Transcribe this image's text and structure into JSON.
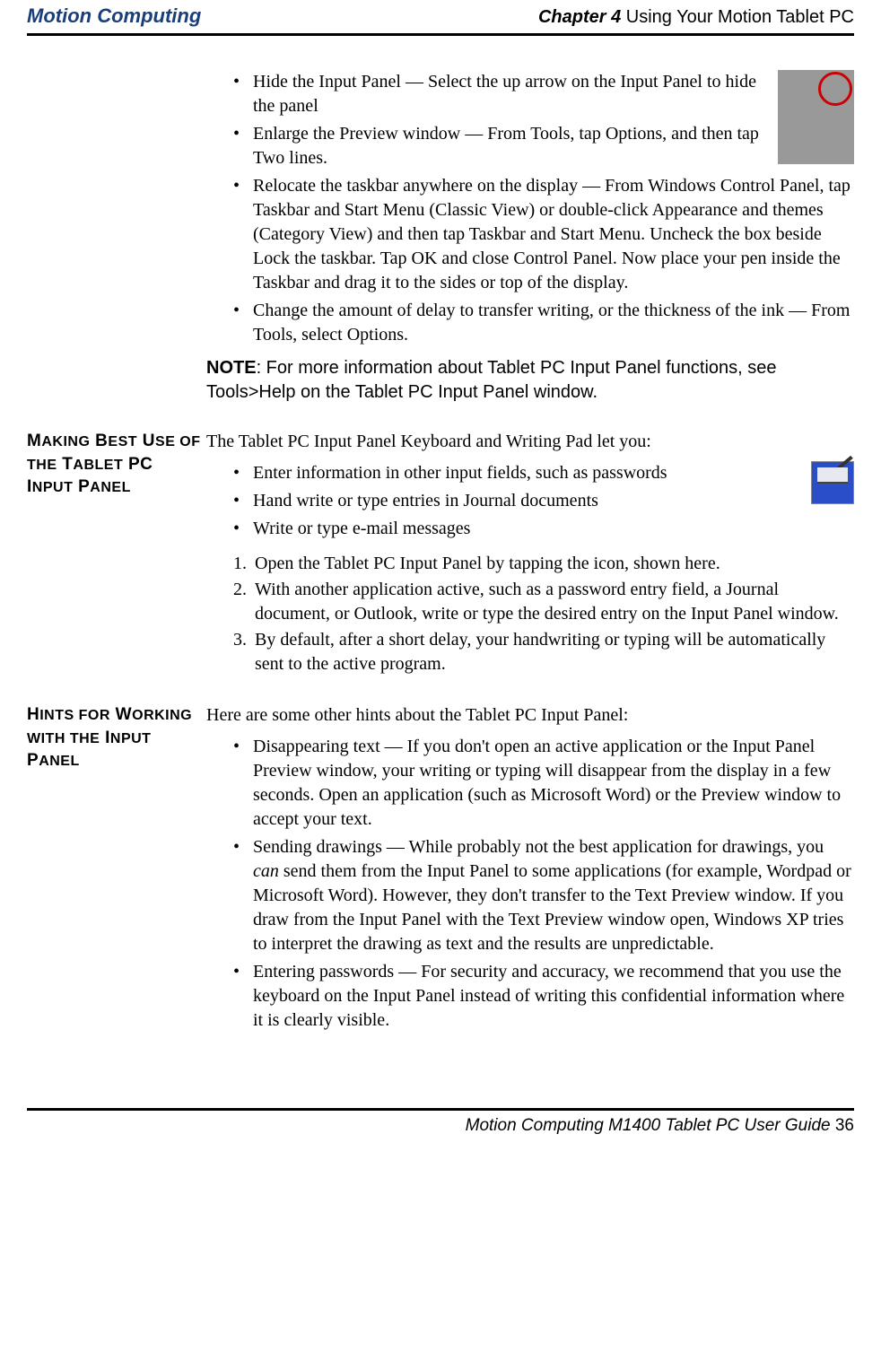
{
  "header": {
    "logo_text": "Motion Computing",
    "chapter_bold": "Chapter 4",
    "chapter_rest": " Using Your Motion Tablet PC"
  },
  "top_bullets": [
    "Hide the Input Panel — Select the up arrow on the Input Panel to hide the panel",
    "Enlarge the Preview window — From Tools, tap Options, and then tap Two lines.",
    "Relocate the taskbar anywhere on the display — From Windows Control Panel, tap Taskbar and Start Menu (Classic View) or double-click Appearance and themes (Category View) and then tap Taskbar and Start Menu. Uncheck the box beside Lock the taskbar. Tap OK and close Control Panel. Now place your pen inside the Taskbar and drag it to the sides or top of the display.",
    "Change the amount of delay to transfer writing, or the thickness of the ink — From Tools, select Options."
  ],
  "note": {
    "label": "NOTE",
    "text": ": For more information about Tablet PC Input Panel functions, see Tools>Help on the Tablet PC Input Panel window."
  },
  "section1": {
    "heading": "MAKING BEST USE OF THE TABLET PC INPUT PANEL",
    "intro": "The Tablet PC Input Panel Keyboard and Writing Pad let you:",
    "bullets": [
      "Enter information in other input fields, such as passwords",
      "Hand write or type entries in Journal documents",
      "Write or type e-mail messages"
    ],
    "numbered": [
      "Open the Tablet PC Input Panel by tapping the icon, shown here.",
      "With another application active, such as a password entry field, a Journal document, or Outlook, write or type the desired entry on the Input Panel window.",
      "By default, after a short delay, your handwriting or typing will be automatically sent to the active program."
    ]
  },
  "section2": {
    "heading": "HINTS FOR WORKING WITH THE INPUT PANEL",
    "intro": "Here are some other hints about the Tablet PC Input Panel:",
    "bullets": [
      {
        "text": "Disappearing text — If you don't open an active application or the Input Panel Preview window, your writing or typing will disappear from the display in a few seconds. Open an application (such as Microsoft Word) or the Preview window to accept your text."
      },
      {
        "pre": "Sending drawings — While probably not the best application for drawings, you ",
        "ital": "can",
        "post": " send them from the Input Panel to some applications (for example, Wordpad or Microsoft Word). However, they don't transfer to the Text Preview window. If you draw from the Input Panel with the Text Preview window open, Windows XP tries to interpret the drawing as text and the results are unpredictable."
      },
      {
        "text": "Entering passwords — For security and accuracy, we recommend that you use the keyboard on the Input Panel instead of writing this confidential information where it is clearly visible."
      }
    ]
  },
  "footer": {
    "text": "Motion Computing M1400 Tablet PC User Guide ",
    "page": "36"
  }
}
